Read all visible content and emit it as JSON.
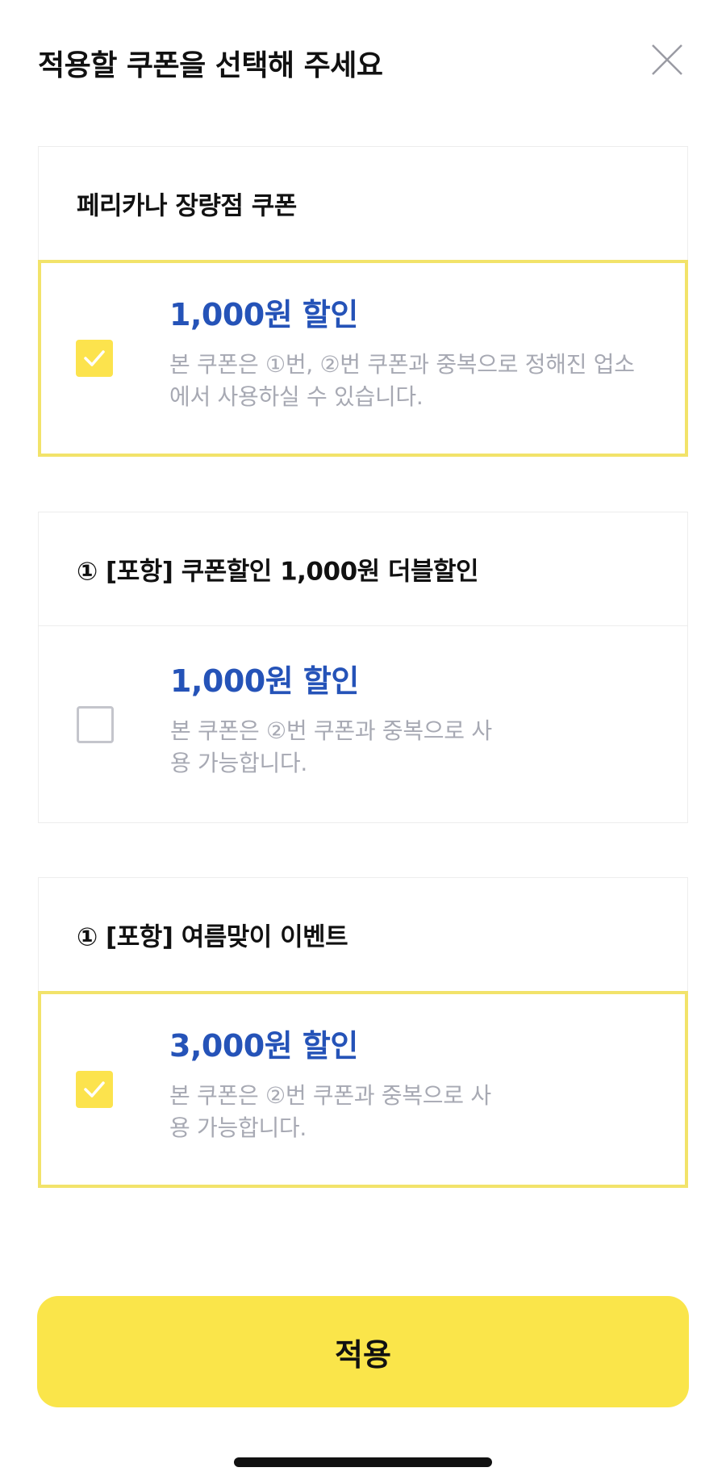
{
  "header": {
    "title": "적용할 쿠폰을 선택해 주세요",
    "close_icon": "close-icon"
  },
  "groups": [
    {
      "title": "페리카나 장량점 쿠폰",
      "coupons": [
        {
          "amount": "1,000원 할인",
          "description": "본 쿠폰은 ①번, ②번 쿠폰과 중복으로 정해진 업소에서 사용하실 수 있습니다.",
          "checked": true
        }
      ]
    },
    {
      "title": "① [포항] 쿠폰할인 1,000원 더블할인",
      "coupons": [
        {
          "amount": "1,000원 할인",
          "description": "본 쿠폰은 ②번 쿠폰과 중복으로 사용 가능합니다.",
          "checked": false
        }
      ]
    },
    {
      "title": "① [포항] 여름맞이 이벤트",
      "coupons": [
        {
          "amount": "3,000원 할인",
          "description": "본 쿠폰은 ②번 쿠폰과 중복으로 사용 가능합니다.",
          "checked": true
        }
      ]
    }
  ],
  "footer": {
    "apply_label": "적용"
  },
  "colors": {
    "accent_yellow": "#fae54a",
    "selected_border": "#f2e36a",
    "amount_blue": "#2553b8",
    "desc_gray": "#a7a9b3"
  }
}
